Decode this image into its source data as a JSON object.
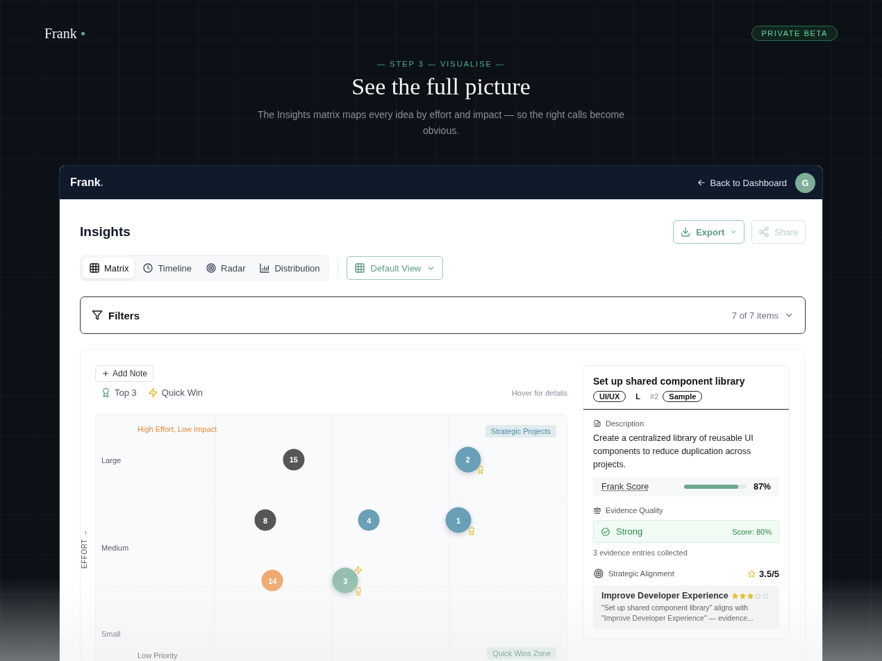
{
  "site": {
    "brand": "Frank",
    "badge": "PRIVATE BETA"
  },
  "hero": {
    "step": "— STEP 3 — VISUALISE —",
    "title": "See the full picture",
    "subtitle": "The Insights matrix maps every idea by effort and impact — so the right calls become obvious."
  },
  "app": {
    "brand": "Frank",
    "brand_dot": ".",
    "back_link": "Back to Dashboard",
    "avatar": "G"
  },
  "page": {
    "title": "Insights",
    "export": "Export",
    "share": "Share",
    "tabs": [
      {
        "label": "Matrix",
        "selected": true
      },
      {
        "label": "Timeline",
        "selected": false
      },
      {
        "label": "Radar",
        "selected": false
      },
      {
        "label": "Distribution",
        "selected": false
      }
    ],
    "view_select": "Default View",
    "filters": {
      "label": "Filters",
      "count": "7 of 7 items"
    }
  },
  "matrix": {
    "add_note": "Add Note",
    "legend": [
      {
        "kind": "top",
        "label": "Top 3"
      },
      {
        "kind": "quick",
        "label": "Quick Win"
      }
    ],
    "hint": "Hover for details",
    "axis": "EFFORT →",
    "rows": [
      "Large",
      "Medium",
      "Small"
    ],
    "quadrants": [
      {
        "label": "High Effort, Low Impact",
        "kind": "warn"
      },
      {
        "label": "Strategic Projects",
        "kind": "strategic"
      },
      {
        "label": "Low Priority",
        "kind": "low"
      },
      {
        "label": "Quick Wins Zone",
        "kind": "quick"
      }
    ],
    "bubbles": [
      {
        "label": "15",
        "color": "#545657",
        "top3": false,
        "quick_win": false
      },
      {
        "label": "2",
        "color": "#6a9fb8",
        "top3": true,
        "quick_win": false
      },
      {
        "label": "8",
        "color": "#545657",
        "top3": false,
        "quick_win": false
      },
      {
        "label": "4",
        "color": "#6a9fb8",
        "top3": false,
        "quick_win": false
      },
      {
        "label": "1",
        "color": "#6a9fb8",
        "top3": true,
        "quick_win": false
      },
      {
        "label": "14",
        "color": "#efa96f",
        "top3": false,
        "quick_win": false
      },
      {
        "label": "3",
        "color": "#94bfae",
        "top3": true,
        "quick_win": true
      }
    ]
  },
  "detail": {
    "title": "Set up shared component library",
    "tags": [
      {
        "label": "UI/UX",
        "kind": "pill"
      },
      {
        "label": "L",
        "kind": "plain"
      },
      {
        "label": "#2",
        "kind": "muted"
      },
      {
        "label": "Sample",
        "kind": "pill"
      }
    ],
    "description_label": "Description",
    "description": "Create a centralized library of reusable UI components to reduce duplication across projects.",
    "frank_score": {
      "label": "Frank Score",
      "level": 0.87,
      "value": "87%"
    },
    "evidence_label": "Evidence Quality",
    "evidence_status": "Strong",
    "evidence_score": "Score: 80%",
    "evidence_note": "3 evidence entries collected",
    "alignment_label": "Strategic Alignment",
    "alignment_rating": "3.5/5",
    "goal": {
      "title": "Improve Developer Experience",
      "stars": 3,
      "text": "\"Set up shared component library\" aligns with \"Improve Developer Experience\" — evidence..."
    }
  }
}
